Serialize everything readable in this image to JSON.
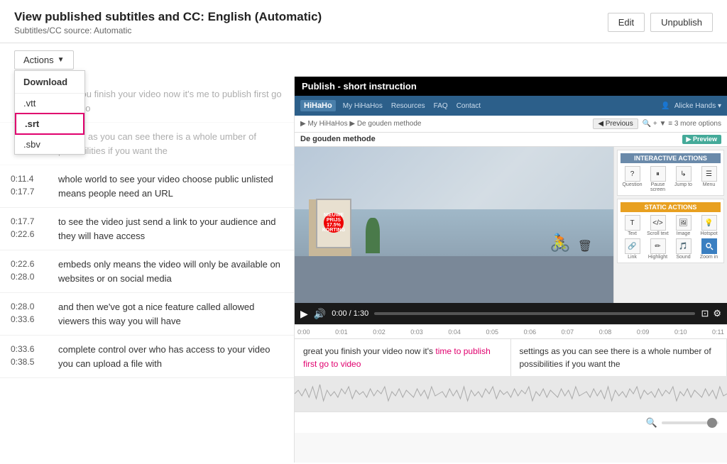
{
  "header": {
    "title": "View published subtitles and CC: English (Automatic)",
    "subtitle": "Subtitles/CC source: Automatic",
    "edit_label": "Edit",
    "unpublish_label": "Unpublish"
  },
  "toolbar": {
    "actions_label": "Actions"
  },
  "dropdown": {
    "download_label": "Download",
    "items": [
      {
        "label": ".vtt",
        "highlighted": false
      },
      {
        "label": ".srt",
        "highlighted": true
      },
      {
        "label": ".sbv",
        "highlighted": false
      }
    ]
  },
  "subtitles": [
    {
      "start": "0:11.4",
      "end": "0:17.7",
      "text": "whole world to see your video choose public unlisted means people need an URL",
      "dimmed": false
    },
    {
      "start": "0:17.7",
      "end": "0:22.6",
      "text": "to see the video just send a link to your audience and they will have access",
      "dimmed": false
    },
    {
      "start": "0:22.6",
      "end": "0:28.0",
      "text": "embeds only means the video will only be available on websites or on social media",
      "dimmed": false
    },
    {
      "start": "0:28.0",
      "end": "0:33.6",
      "text": "and then we've got a nice feature called allowed viewers this way you will have",
      "dimmed": false
    },
    {
      "start": "0:33.6",
      "end": "0:38.5",
      "text": "complete control over who has access to your video you can upload a file with",
      "dimmed": false
    }
  ],
  "video": {
    "title": "Publish - short instruction",
    "inner_title": "De gouden methode",
    "preview_btn": "Preview",
    "time_display": "0:00 / 1:30",
    "controls": {
      "play": "▶",
      "volume": "🔊"
    },
    "interactive_actions_label": "INTERACTIVE ACTIONS",
    "static_actions_label": "STATIC ACTIONS",
    "icons_interactive": [
      {
        "icon": "?",
        "label": "Question"
      },
      {
        "icon": "⏸",
        "label": "Pause screen"
      },
      {
        "icon": "↳",
        "label": "Jump to"
      },
      {
        "icon": "☰",
        "label": "Menu"
      }
    ],
    "icons_static": [
      {
        "icon": "T",
        "label": "Text"
      },
      {
        "icon": "</>",
        "label": "Scroll text"
      },
      {
        "icon": "🖼",
        "label": "Image"
      },
      {
        "icon": "💡",
        "label": "Hotspot"
      },
      {
        "icon": "🔗",
        "label": "Link"
      },
      {
        "icon": "✏",
        "label": "Highlight"
      },
      {
        "icon": "🎵",
        "label": "Sound"
      },
      {
        "icon": "🔍",
        "label": "Zoom in"
      }
    ],
    "ruler_marks": [
      "0:00",
      "0:01",
      "0:02",
      "0:03",
      "0:04",
      "0:05",
      "0:06",
      "0:07",
      "0:08",
      "0:09",
      "0:10",
      "0:11"
    ],
    "subtitle_left": "great you finish your video now it's time to publish first go to video",
    "subtitle_left_highlight": "time to publish first go to video",
    "subtitle_right": "settings as you can see there is a whole number of possibilities if you want the"
  },
  "zoom": {
    "icon": "🔍"
  }
}
